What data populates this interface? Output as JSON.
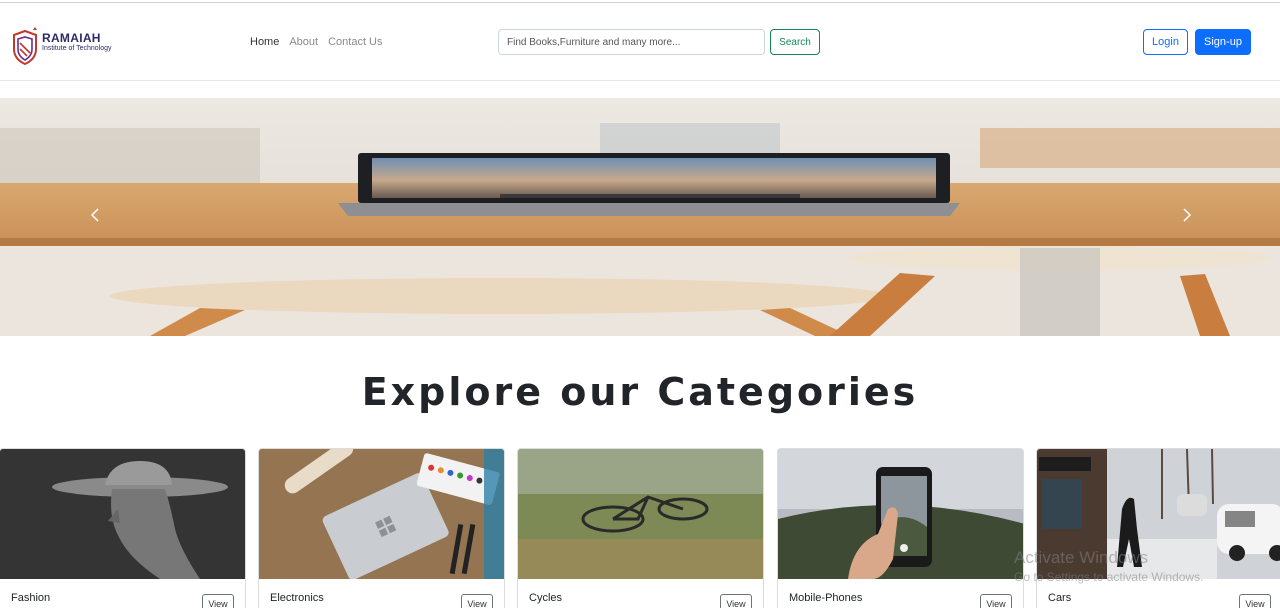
{
  "brand": {
    "name": "RAMAIAH",
    "subtitle": "Institute of Technology"
  },
  "nav": {
    "links": [
      {
        "label": "Home",
        "active": true
      },
      {
        "label": "About",
        "active": false
      },
      {
        "label": "Contact Us",
        "active": false
      }
    ]
  },
  "search": {
    "placeholder": "Find Books,Furniture and many more...",
    "button_label": "Search"
  },
  "auth": {
    "login_label": "Login",
    "signup_label": "Sign-up"
  },
  "hero": {
    "prev_icon": "chevron-left-icon",
    "next_icon": "chevron-right-icon"
  },
  "categories": {
    "title": "Explore our Categories",
    "items": [
      {
        "label": "Fashion",
        "button": "View"
      },
      {
        "label": "Electronics",
        "button": "View"
      },
      {
        "label": "Cycles",
        "button": "View"
      },
      {
        "label": "Mobile-Phones",
        "button": "View"
      },
      {
        "label": "Cars",
        "button": "View"
      }
    ]
  },
  "watermark": {
    "line1": "Activate Windows",
    "line2": "Go to Settings to activate Windows."
  },
  "colors": {
    "primary": "#0d6efd",
    "success": "#198754",
    "brand": "#2c2a6b"
  }
}
